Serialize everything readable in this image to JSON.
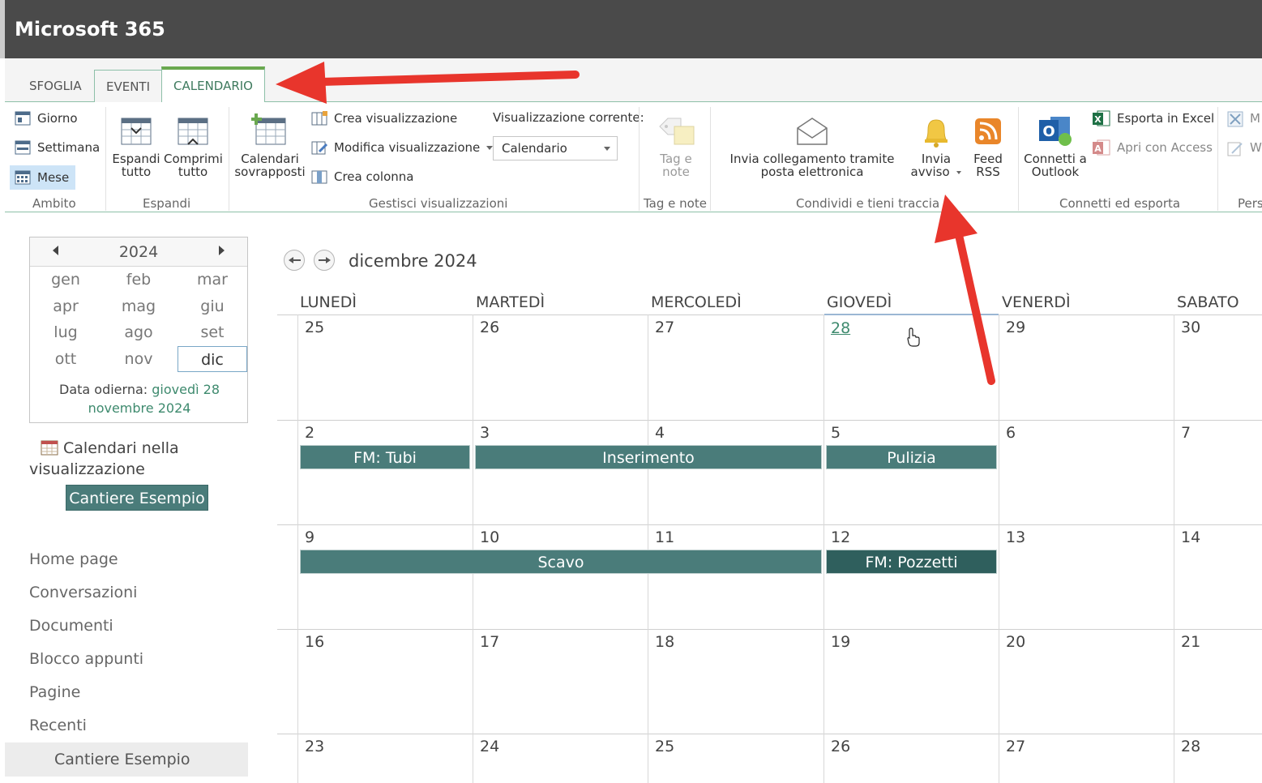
{
  "suite": {
    "brand": "Microsoft 365"
  },
  "tabs": [
    "SFOGLIA",
    "EVENTI",
    "CALENDARIO"
  ],
  "ribbon": {
    "scope": {
      "items": [
        "Giorno",
        "Settimana",
        "Mese"
      ],
      "selected": "Mese",
      "label": "Ambito"
    },
    "expand": {
      "expand_all": "Espandi tutto",
      "collapse_all": "Comprimi tutto",
      "label": "Espandi"
    },
    "overlay": {
      "label": "Calendari sovrapposti"
    },
    "manage_views": {
      "create_view": "Crea visualizzazione",
      "modify_view": "Modifica visualizzazione",
      "create_column": "Crea colonna",
      "current_view_label": "Visualizzazione corrente:",
      "current_view_value": "Calendario",
      "label": "Gestisci visualizzazioni"
    },
    "tags": {
      "tags_notes": "Tag e note",
      "label": "Tag e note"
    },
    "share": {
      "email_link": "Invia collegamento tramite posta elettronica",
      "alert": "Invia avviso",
      "rss": "Feed RSS",
      "label": "Condividi e tieni traccia"
    },
    "connect": {
      "outlook": "Connetti a Outlook",
      "excel": "Esporta in Excel",
      "access": "Apri con Access",
      "label": "Connetti ed esporta"
    },
    "personal": {
      "item1": "M",
      "item2": "W",
      "label": "Pers"
    }
  },
  "minical": {
    "year": "2024",
    "months": [
      "gen",
      "feb",
      "mar",
      "apr",
      "mag",
      "giu",
      "lug",
      "ago",
      "set",
      "ott",
      "nov",
      "dic"
    ],
    "selected_month": "dic",
    "today_label": "Data odierna:",
    "today_value_1": "giovedì 28",
    "today_value_2": "novembre 2024"
  },
  "calendars_in_view": {
    "label_1": "Calendari nella",
    "label_2": "visualizzazione",
    "chip": "Cantiere Esempio"
  },
  "nav": [
    "Home page",
    "Conversazioni",
    "Documenti",
    "Blocco appunti",
    "Pagine",
    "Recenti"
  ],
  "nav_current": "Cantiere Esempio",
  "calendar": {
    "title": "dicembre 2024",
    "day_headers": [
      "LUNEDÌ",
      "MARTEDÌ",
      "MERCOLEDÌ",
      "GIOVEDÌ",
      "VENERDÌ",
      "SABATO"
    ],
    "weeks": [
      [
        "25",
        "26",
        "27",
        "28",
        "29",
        "30"
      ],
      [
        "2",
        "3",
        "4",
        "5",
        "6",
        "7"
      ],
      [
        "9",
        "10",
        "11",
        "12",
        "13",
        "14"
      ],
      [
        "16",
        "17",
        "18",
        "19",
        "20",
        "21"
      ],
      [
        "23",
        "24",
        "25",
        "26",
        "27",
        "28"
      ]
    ],
    "today_date": "28",
    "events": [
      {
        "title": "FM: Tubi"
      },
      {
        "title": "Inserimento"
      },
      {
        "title": "Pulizia"
      },
      {
        "title": "Scavo"
      },
      {
        "title": "FM: Pozzetti"
      }
    ]
  },
  "colors": {
    "event": "#4a7c7a",
    "event_dark": "#2f5f5d",
    "accent": "#6aa84f",
    "suitebar": "#4a4a4a",
    "annotation": "#e8352c"
  }
}
